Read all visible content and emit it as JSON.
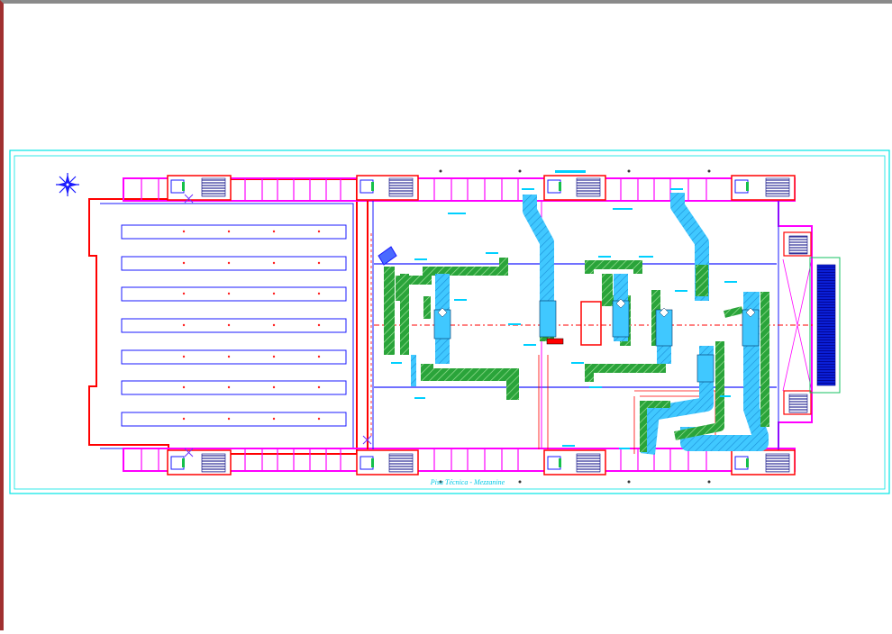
{
  "drawing": {
    "caption": "Pisa Técnica - Mezzanine"
  },
  "colors": {
    "sheet_border": "#00e5e5",
    "walls": "#ff00ff",
    "structure_red": "#ff0000",
    "duct_cyan": "#3fc8ff",
    "duct_green": "#27a838",
    "lines_blue": "#1a1aff",
    "annotation": "#00d0ff",
    "stairs": "#0000aa",
    "background": "#ffffff"
  },
  "icons": {
    "north_arrow": "compass-star-icon"
  }
}
